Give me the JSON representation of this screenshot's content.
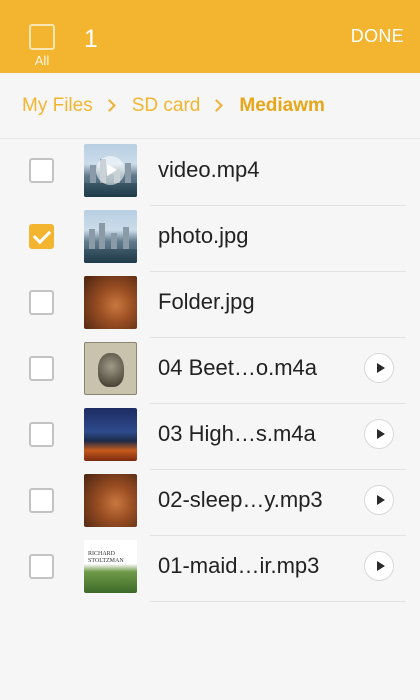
{
  "header": {
    "select_all_label": "All",
    "selected_count": "1",
    "done_label": "DONE"
  },
  "breadcrumb": [
    "My Files",
    "SD card",
    "Mediawm"
  ],
  "files": [
    {
      "name": "video.mp4",
      "checked": false,
      "thumb": "video-thumbnail",
      "playable": false
    },
    {
      "name": "photo.jpg",
      "checked": true,
      "thumb": "photo-thumbnail",
      "playable": false
    },
    {
      "name": "Folder.jpg",
      "checked": false,
      "thumb": "folder-art-thumbnail",
      "playable": false
    },
    {
      "name": "04 Beet…o.m4a",
      "checked": false,
      "thumb": "album-art-thumbnail",
      "playable": true
    },
    {
      "name": "03 High…s.m4a",
      "checked": false,
      "thumb": "album-art-thumbnail",
      "playable": true
    },
    {
      "name": "02-sleep…y.mp3",
      "checked": false,
      "thumb": "album-art-thumbnail",
      "playable": true
    },
    {
      "name": "01-maid…ir.mp3",
      "checked": false,
      "thumb": "album-art-thumbnail",
      "playable": true
    }
  ],
  "album_art_text": "RICHARD STOLTZMAN",
  "colors": {
    "accent": "#f3b530",
    "breadcrumb_current": "#e8a619",
    "text": "#222222",
    "background": "#f6f6f6"
  }
}
